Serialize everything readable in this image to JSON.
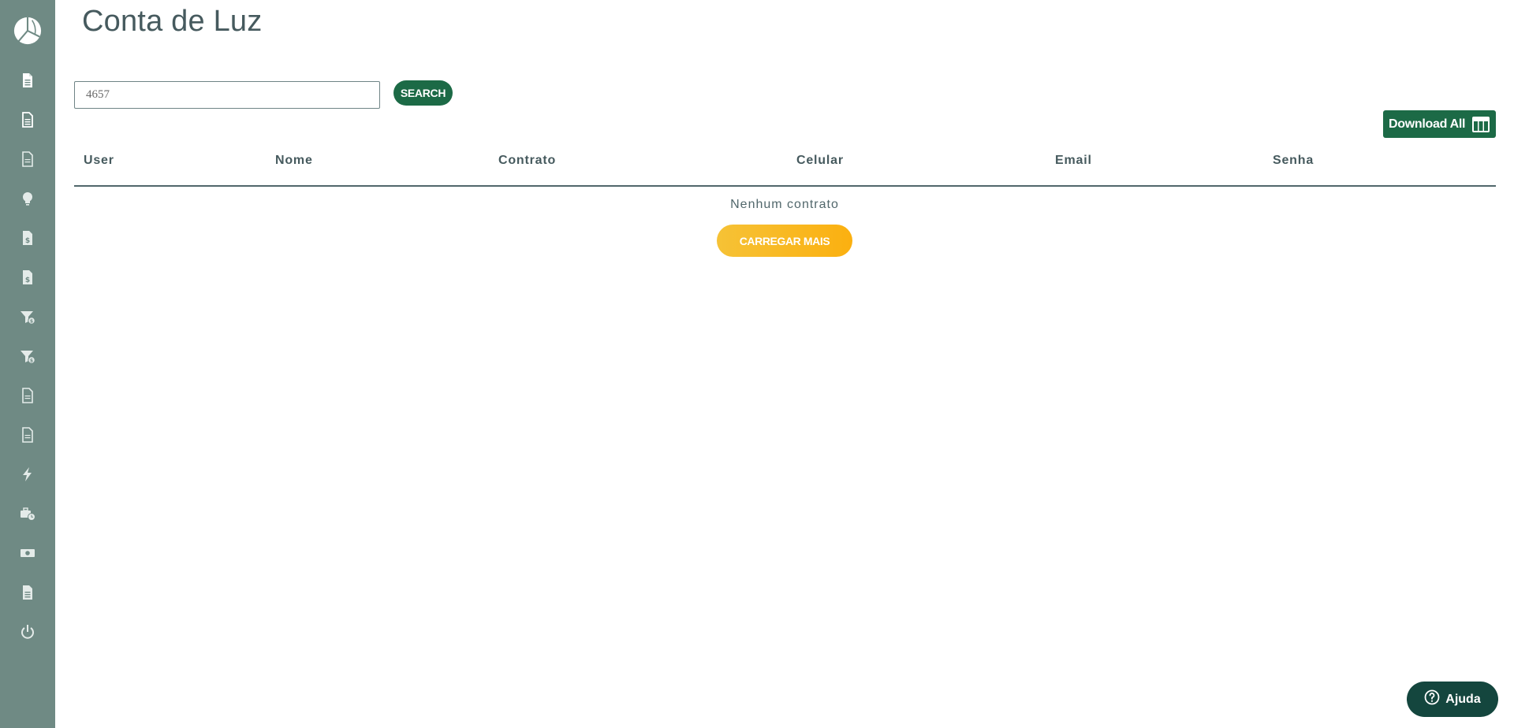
{
  "page": {
    "title": "Conta de Luz"
  },
  "search": {
    "value": "4657",
    "button_label": "SEARCH"
  },
  "download": {
    "label": "Download All",
    "icon": "table-icon"
  },
  "table": {
    "columns": [
      "User",
      "Nome",
      "Contrato",
      "Celular",
      "Email",
      "Senha"
    ],
    "empty_message": "Nenhum contrato"
  },
  "load_more": {
    "label": "CARREGAR MAIS"
  },
  "help": {
    "label": "Ajuda",
    "icon": "question-circle-icon"
  },
  "sidebar": {
    "logo": "logo-icon",
    "items": [
      {
        "icon": "file-lines-icon"
      },
      {
        "icon": "file-lines-icon"
      },
      {
        "icon": "file-outline-icon"
      },
      {
        "icon": "lightbulb-icon"
      },
      {
        "icon": "file-dollar-icon"
      },
      {
        "icon": "file-dollar-icon"
      },
      {
        "icon": "filter-dollar-icon"
      },
      {
        "icon": "filter-dollar-icon"
      },
      {
        "icon": "file-outline-icon"
      },
      {
        "icon": "file-outline-icon"
      },
      {
        "icon": "bolt-icon"
      },
      {
        "icon": "briefcase-clock-icon"
      },
      {
        "icon": "money-bill-icon"
      },
      {
        "icon": "file-lines-icon"
      },
      {
        "icon": "power-icon"
      }
    ]
  },
  "colors": {
    "sidebar": "#6f8a84",
    "primary": "#1c6a46",
    "accent": "#fbb010",
    "text": "#465a5e",
    "help_bg": "#14463e"
  }
}
